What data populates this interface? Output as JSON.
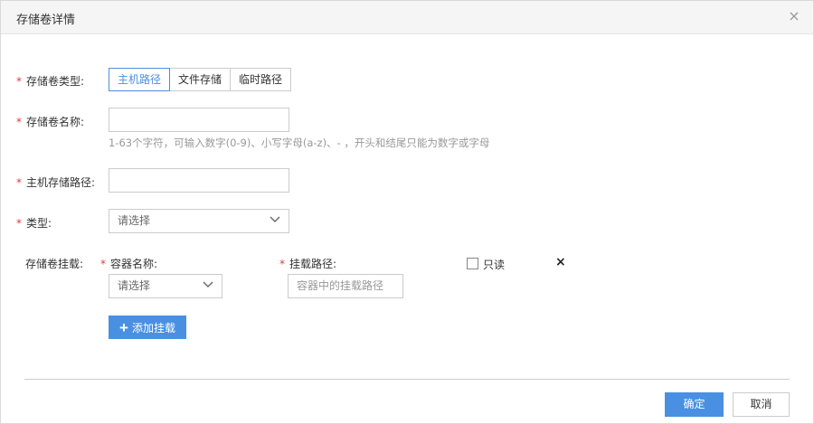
{
  "dialog": {
    "title": "存储卷详情",
    "close_glyph": "×"
  },
  "required_mark": "*",
  "form": {
    "volume_type": {
      "label": "存储卷类型:",
      "options": [
        "主机路径",
        "文件存储",
        "临时路径"
      ],
      "selected": "主机路径"
    },
    "volume_name": {
      "label": "存储卷名称:",
      "value": "",
      "hint": "1-63个字符，可输入数字(0-9)、小写字母(a-z)、- ，开头和结尾只能为数字或字母"
    },
    "host_path": {
      "label": "主机存储路径:",
      "value": ""
    },
    "type": {
      "label": "类型:",
      "selected": "请选择"
    },
    "mount": {
      "label": "存储卷挂载:",
      "container_label": "容器名称:",
      "container_selected": "请选择",
      "path_label": "挂载路径:",
      "path_placeholder": "容器中的挂载路径",
      "readonly_label": "只读",
      "readonly_checked": false,
      "remove_glyph": "×",
      "add_label": "添加挂载"
    }
  },
  "footer": {
    "confirm_label": "确定",
    "cancel_label": "取消"
  },
  "colors": {
    "accent": "#4a90e2",
    "required": "#e4393c",
    "hint": "#999999"
  }
}
